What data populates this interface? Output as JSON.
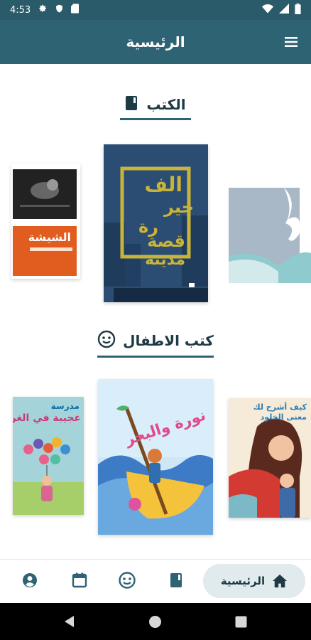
{
  "status_bar": {
    "time": "4:53"
  },
  "app_bar": {
    "title": "الرئيسية"
  },
  "sections": {
    "books": {
      "title": "الكتب"
    },
    "kids": {
      "title": "كتب الاطفال"
    }
  },
  "books": {
    "center": {
      "title_line1": "الف",
      "title_line2": "جير",
      "title_line3": "رة",
      "subtitle_line1": "قصة",
      "subtitle_line2": "مدينة"
    },
    "left": {
      "title": "الشيشة"
    }
  },
  "kids_books": {
    "center": {
      "title": "نورة والبحر"
    },
    "left": {
      "title_top": "مدرسة",
      "title_main": "عجيبة في الغريب"
    },
    "right": {
      "title": "كيف أشرح لك معنى الخلود"
    }
  },
  "bottom_nav": {
    "home_label": "الرئيسية"
  },
  "colors": {
    "primary": "#2d6373",
    "status_bar": "#2a5b6a",
    "accent_gold": "#c9b43b",
    "nav_active_bg": "#e1eaed"
  }
}
